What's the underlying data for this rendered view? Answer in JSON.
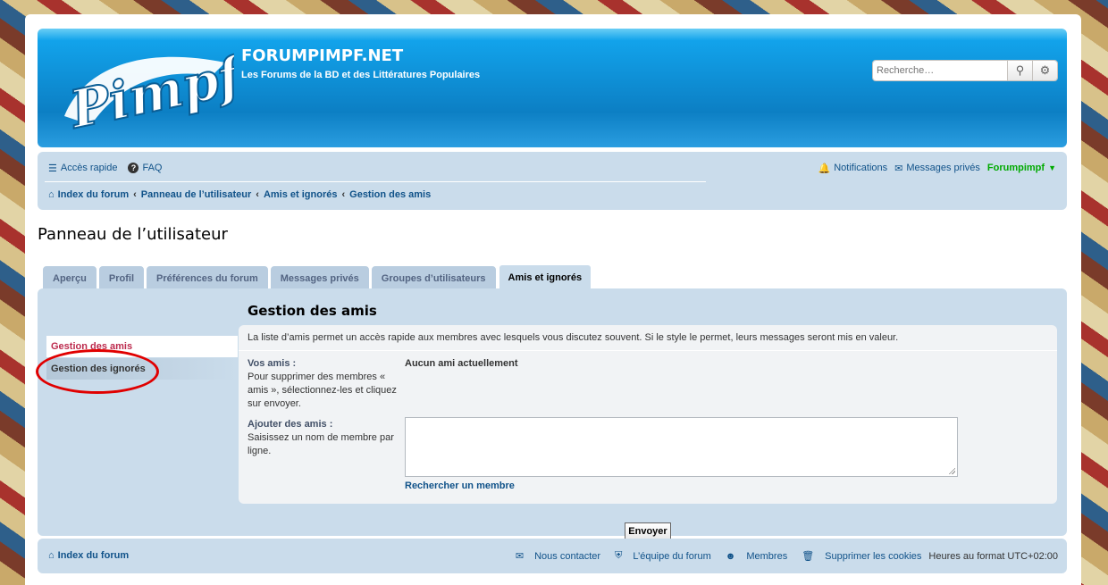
{
  "header": {
    "site_title": "FORUMPIMPF.NET",
    "site_desc": "Les Forums de la BD et des Littératures Populaires",
    "logo_text": "Pimpf",
    "search_placeholder": "Recherche…"
  },
  "nav": {
    "quick_access": "Accès rapide",
    "faq": "FAQ",
    "notifications": "Notifications",
    "private_messages": "Messages privés",
    "username": "Forumpimpf"
  },
  "breadcrumbs": [
    "Index du forum",
    "Panneau de l’utilisateur",
    "Amis et ignorés",
    "Gestion des amis"
  ],
  "page_title": "Panneau de l’utilisateur",
  "tabs": [
    "Aperçu",
    "Profil",
    "Préférences du forum",
    "Messages privés",
    "Groupes d’utilisateurs",
    "Amis et ignorés"
  ],
  "sidebar": {
    "friends_link": "Gestion des amis",
    "foes_link": "Gestion des ignorés"
  },
  "content": {
    "title": "Gestion des amis",
    "intro": "La liste d’amis permet un accès rapide aux membres avec lesquels vous discutez souvent. Si le style le permet, leurs messages seront mis en valeur.",
    "your_friends_label": "Vos amis :",
    "your_friends_help": "Pour supprimer des membres « amis », sélectionnez-les et cliquez sur envoyer.",
    "no_friends": "Aucun ami actuellement",
    "add_friends_label": "Ajouter des amis :",
    "add_friends_help": "Saisissez un nom de membre par ligne.",
    "find_member": "Rechercher un membre",
    "submit": "Envoyer"
  },
  "footer": {
    "home": "Index du forum",
    "contact": "Nous contacter",
    "team": "L’équipe du forum",
    "members": "Membres",
    "delete_cookies": "Supprimer les cookies",
    "timezone": "Heures au format UTC+02:00"
  },
  "colors": {
    "header_blue": "#0c7fc4",
    "nav_bg": "#cadceb",
    "link": "#105289",
    "username": "#00aa00",
    "annotation_circle": "#e00000"
  }
}
